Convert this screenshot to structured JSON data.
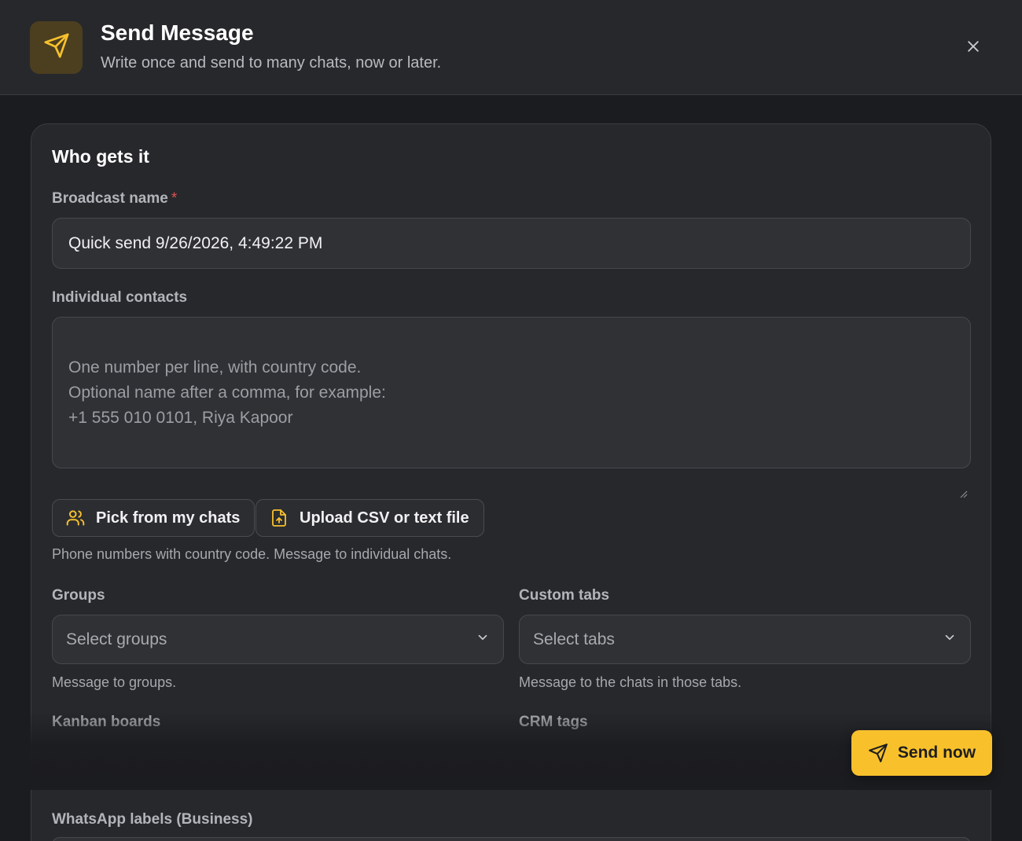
{
  "header": {
    "icon": "send-icon",
    "title": "Send Message",
    "subtitle": "Write once and send to many chats, now or later.",
    "close_icon": "close-icon"
  },
  "who_gets_it": {
    "section_title": "Who gets it",
    "broadcast_name": {
      "label": "Broadcast name",
      "required_mark": "*",
      "value": "Quick send 9/26/2026, 4:49:22 PM"
    },
    "individual_contacts": {
      "label": "Individual contacts",
      "placeholder": "One number per line, with country code.\nOptional name after a comma, for example:\n+1 555 010 0101, Riya Kapoor",
      "value": ""
    },
    "buttons": {
      "pick_chats": {
        "label": "Pick from my chats",
        "icon": "users-icon"
      },
      "upload_file": {
        "label": "Upload CSV or text file",
        "icon": "file-upload-icon"
      }
    },
    "contacts_help": "Phone numbers with country code. Message to individual chats.",
    "groups": {
      "label": "Groups",
      "placeholder": "Select groups",
      "help": "Message to groups."
    },
    "custom_tabs": {
      "label": "Custom tabs",
      "placeholder": "Select tabs",
      "help": "Message to the chats in those tabs."
    },
    "kanban_boards": {
      "label": "Kanban boards"
    },
    "crm_tags": {
      "label": "CRM tags"
    },
    "whatsapp_labels": {
      "label": "WhatsApp labels (Business)"
    }
  },
  "footer": {
    "send_now": {
      "label": "Send now",
      "icon": "send-icon"
    }
  },
  "colors": {
    "accent": "#f8c12c",
    "background": "#1b1c1f",
    "panel": "#27282c",
    "required": "#e05252"
  }
}
